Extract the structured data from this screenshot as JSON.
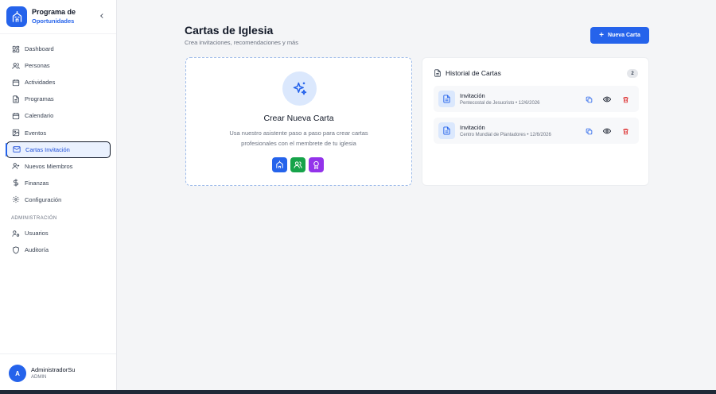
{
  "brand": {
    "title": "Programa de",
    "subtitle": "Oportunidades",
    "accent": "#2563eb"
  },
  "sidebar": {
    "items": [
      {
        "label": "Dashboard",
        "icon": "dashboard-icon"
      },
      {
        "label": "Personas",
        "icon": "users-icon"
      },
      {
        "label": "Actividades",
        "icon": "calendar-icon"
      },
      {
        "label": "Programas",
        "icon": "document-icon"
      },
      {
        "label": "Calendario",
        "icon": "calendar-grid-icon"
      },
      {
        "label": "Eventos",
        "icon": "image-icon"
      },
      {
        "label": "Cartas Invitación",
        "icon": "mail-icon",
        "active": true
      },
      {
        "label": "Nuevos Miembros",
        "icon": "user-plus-icon"
      },
      {
        "label": "Finanzas",
        "icon": "dollar-icon"
      },
      {
        "label": "Configuración",
        "icon": "gear-icon"
      }
    ],
    "admin_section_label": "ADMINISTRACIÓN",
    "admin_items": [
      {
        "label": "Usuarios",
        "icon": "user-cog-icon"
      },
      {
        "label": "Auditoría",
        "icon": "shield-icon"
      }
    ]
  },
  "user": {
    "initial": "A",
    "name": "AdministradorSu",
    "role": "ADMIN"
  },
  "header": {
    "title": "Cartas de Iglesia",
    "subtitle": "Crea invitaciones, recomendaciones y más",
    "new_button": "Nueva Carta"
  },
  "create_card": {
    "title": "Crear Nueva Carta",
    "description": "Usa nuestro asistente paso a paso para crear cartas profesionales con el membrete de tu iglesia",
    "icons": [
      {
        "name": "church-icon",
        "color": "#2563eb"
      },
      {
        "name": "group-icon",
        "color": "#16a34a"
      },
      {
        "name": "award-icon",
        "color": "#9333ea"
      }
    ]
  },
  "history": {
    "title": "Historial de Cartas",
    "count": "2",
    "letters": [
      {
        "type": "Invitación",
        "meta": "Pentecostal de Jesucristo • 12/6/2026"
      },
      {
        "type": "Invitación",
        "meta": "Centro Mundial de Plantadores • 12/6/2026"
      }
    ]
  },
  "colors": {
    "primary": "#2563eb",
    "danger": "#dc2626",
    "success": "#16a34a",
    "purple": "#9333ea"
  }
}
